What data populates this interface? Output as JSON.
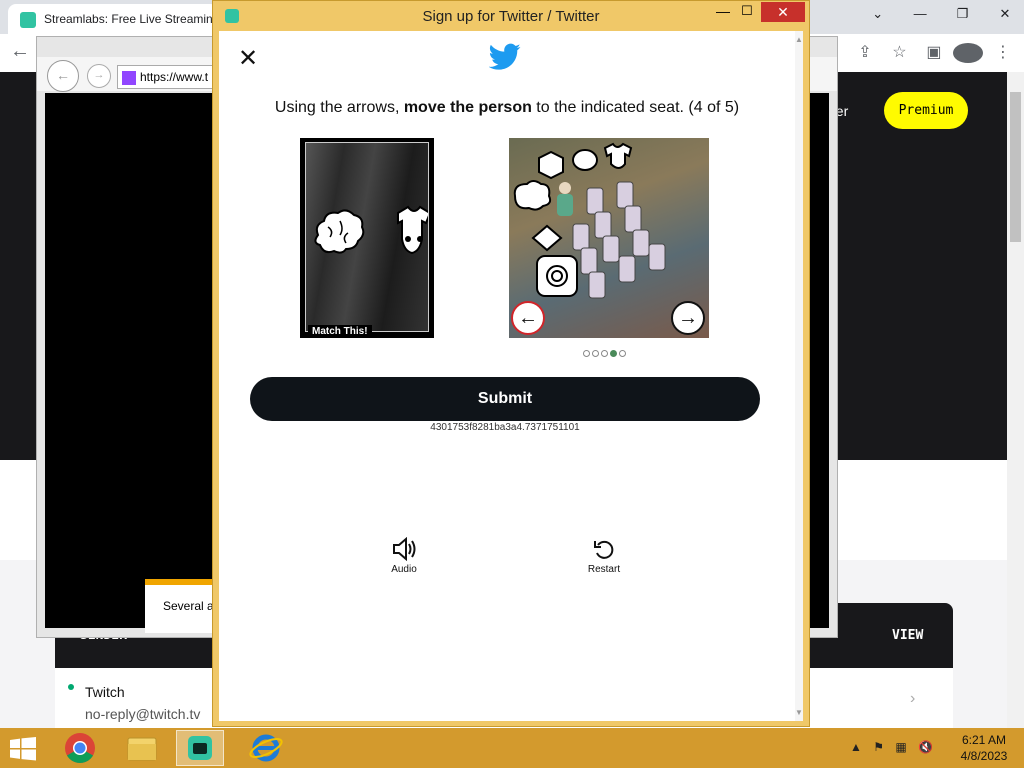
{
  "browser": {
    "tab_title": "Streamlabs: Free Live Streaming",
    "premium_label": "Premium",
    "member_text": "ber",
    "min_glyph": "—",
    "max_glyph": "❐",
    "close_glyph": "✕"
  },
  "popup": {
    "url": "https://www.t",
    "notice": "Several ac"
  },
  "mail": {
    "sender_header": "SENDER",
    "view_header": "VIEW",
    "from": "Twitch",
    "email": "no-reply@twitch.tv"
  },
  "dialog": {
    "title": "Sign up for Twitter / Twitter",
    "min_glyph": "—",
    "max_glyph": "☐",
    "close_glyph": "✕",
    "close_x": "✕",
    "instruction_pre": "Using the arrows, ",
    "instruction_bold": "move the person",
    "instruction_post": " to the indicated seat. (4 of 5)",
    "match_label": "Match This!",
    "left_arrow": "←",
    "right_arrow": "→",
    "progress": {
      "current": 4,
      "total": 5
    },
    "submit_label": "Submit",
    "session_id": "4301753f8281ba3a4.7371751101",
    "audio_label": "Audio",
    "restart_label": "Restart",
    "accent_color": "#1d9bf0"
  },
  "taskbar": {
    "time": "6:21 AM",
    "date": "4/8/2023",
    "tray_arrow": "▲"
  }
}
